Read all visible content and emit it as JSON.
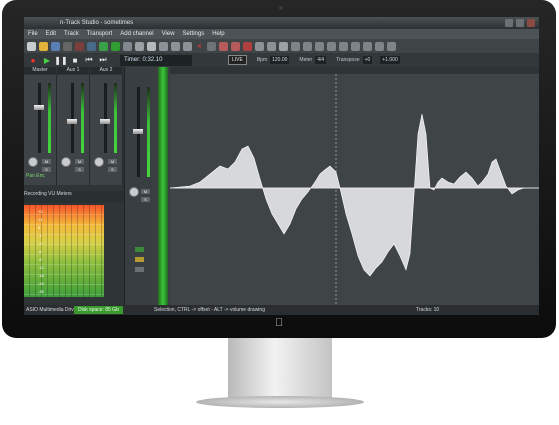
{
  "window": {
    "title": "n-Track Studio - sometimes"
  },
  "menu": [
    "File",
    "Edit",
    "Track",
    "Transport",
    "Add channel",
    "View",
    "Settings",
    "Help"
  ],
  "transport": {
    "timer_label": "Timer: 0:32.10",
    "live_label": "LIVE",
    "bpm_label": "Bpm",
    "bpm_value": "120.00",
    "meter_label": "Meter",
    "meter_value": "4/4",
    "transpose_label": "Transpose",
    "transpose_value": "+0",
    "vol_value": "+1.000"
  },
  "mixer": {
    "headers": [
      "Master",
      "Aux 1",
      "Aux 2"
    ],
    "channel_label": "Pan Enc",
    "vu_header": "Recording VU Meters",
    "vu_scale": [
      "+2",
      "+1",
      "0",
      "-1",
      "-3",
      "-6",
      "-9",
      "-12",
      "-18",
      "-24",
      "-35"
    ]
  },
  "status": {
    "disk_space": "Disk space: 85 Gb",
    "hint": "Selection, CTRL -> offset - ALT -> volume drawing",
    "tracks": "Tracks: 10",
    "device": "ASIO Multimedia Driver"
  },
  "colors": {
    "waveform_fill": "#d6d8da",
    "waveform_line": "#ffffff",
    "meter_green": "#3cbf3a",
    "bg": "#3f4447"
  }
}
